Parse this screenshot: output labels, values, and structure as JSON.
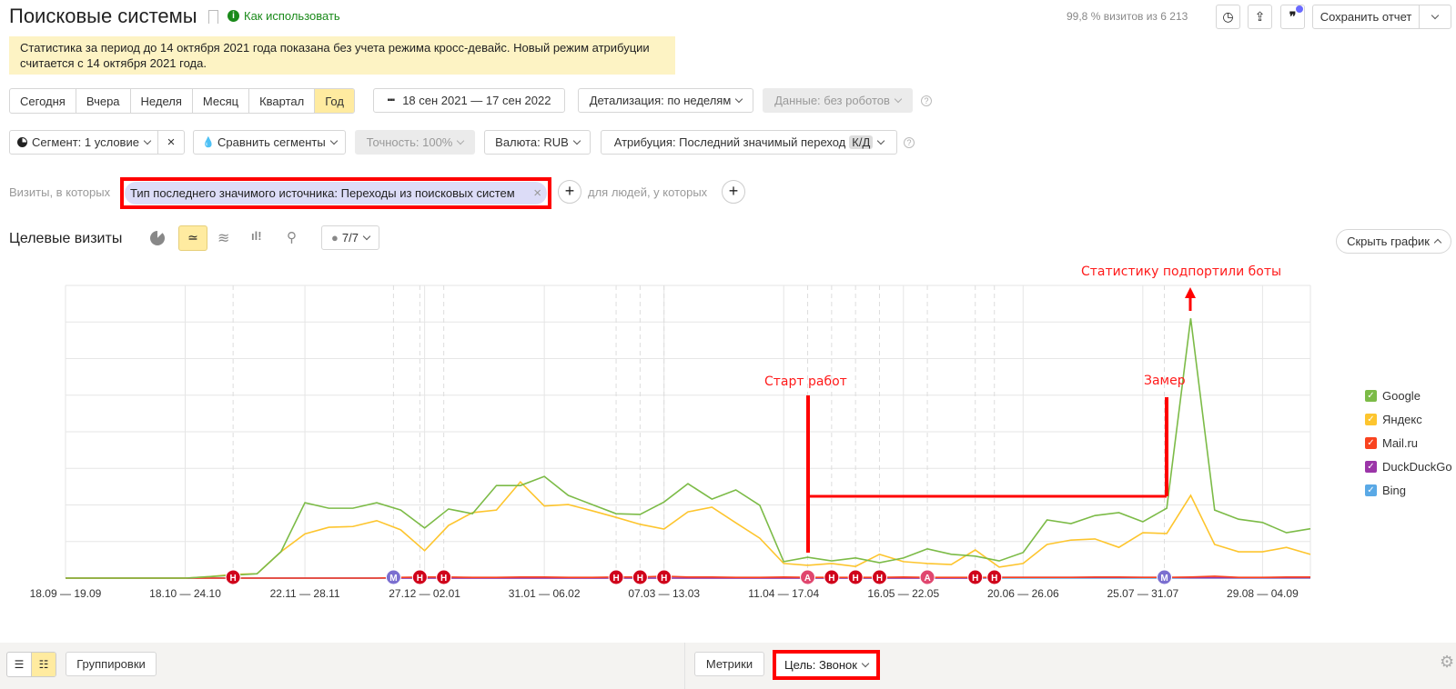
{
  "header": {
    "title": "Поисковые системы",
    "how_to": "Как использовать",
    "visits_info": "99,8 % визитов из 6 213",
    "save_report": "Сохранить отчет"
  },
  "notice": "Статистика за период до 14 октября 2021 года показана без учета режима кросс-девайс. Новый режим атрибуции считается с 14 октября 2021 года.",
  "periods": [
    {
      "label": "Сегодня"
    },
    {
      "label": "Вчера"
    },
    {
      "label": "Неделя"
    },
    {
      "label": "Месяц"
    },
    {
      "label": "Квартал"
    },
    {
      "label": "Год",
      "active": true
    }
  ],
  "date_range": "18 сен 2021 — 17 сен 2022",
  "detail": "Детализация: по неделям",
  "data_filter": "Данные: без роботов",
  "segment": "Сегмент: 1 условие",
  "compare": "Сравнить сегменты",
  "accuracy": "Точность: 100%",
  "currency": "Валюта: RUB",
  "attribution": "Атрибуция: Последний значимый переход",
  "attribution_badge": "К/Д",
  "filter": {
    "prefix": "Визиты, в которых",
    "chip": "Тип последнего значимого источника: Переходы из поисковых систем",
    "people": "для людей, у которых"
  },
  "chart_header": {
    "title": "Целевые визиты",
    "annotations_count": "7/7",
    "hide_chart": "Скрыть график",
    "active_view": "line"
  },
  "colors": {
    "accent": "#ffeba0",
    "highlight": "#ff0000"
  },
  "chart_data": {
    "type": "line",
    "ylim": [
      0,
      8
    ],
    "grid": true,
    "legend_placement": "right",
    "x_ticks": [
      {
        "index": 0,
        "label": "18.09 — 19.09"
      },
      {
        "index": 5,
        "label": "18.10 — 24.10"
      },
      {
        "index": 10,
        "label": "22.11 — 28.11"
      },
      {
        "index": 15,
        "label": "27.12 — 02.01"
      },
      {
        "index": 20,
        "label": "31.01 — 06.02"
      },
      {
        "index": 25,
        "label": "07.03 — 13.03"
      },
      {
        "index": 30,
        "label": "11.04 — 17.04"
      },
      {
        "index": 35,
        "label": "16.05 — 22.05"
      },
      {
        "index": 40,
        "label": "20.06 — 26.06"
      },
      {
        "index": 45,
        "label": "25.07 — 31.07"
      },
      {
        "index": 50,
        "label": "29.08 — 04.09"
      }
    ],
    "series": [
      {
        "name": "Google",
        "color": "#7cbb47",
        "values": [
          0,
          0,
          0,
          0,
          0,
          0,
          0.04,
          0.08,
          0.12,
          0.72,
          2.06,
          1.91,
          1.91,
          2.06,
          1.86,
          1.37,
          1.89,
          1.76,
          2.53,
          2.53,
          2.78,
          2.26,
          2.01,
          1.76,
          1.74,
          2.08,
          2.58,
          2.16,
          2.41,
          1.99,
          0.45,
          0.57,
          0.47,
          0.55,
          0.42,
          0.55,
          0.8,
          0.65,
          0.6,
          0.47,
          0.7,
          1.59,
          1.49,
          1.71,
          1.79,
          1.54,
          1.91,
          7.1,
          1.86,
          1.61,
          1.52,
          1.24,
          1.35
        ]
      },
      {
        "name": "Яндекс",
        "color": "#fdc52e",
        "values": [
          0,
          0,
          0,
          0,
          0,
          0,
          0.04,
          0.1,
          0.12,
          0.72,
          1.21,
          1.39,
          1.41,
          1.57,
          1.32,
          0.75,
          1.44,
          1.79,
          1.86,
          2.63,
          1.97,
          2.01,
          1.84,
          1.66,
          1.47,
          1.34,
          1.81,
          1.94,
          1.51,
          1.09,
          0.4,
          0.35,
          0.4,
          0.32,
          0.65,
          0.45,
          0.4,
          0.37,
          0.77,
          0.3,
          0.4,
          0.92,
          1.04,
          1.07,
          0.84,
          1.24,
          1.22,
          2.26,
          0.92,
          0.72,
          0.72,
          0.84,
          0.65
        ]
      },
      {
        "name": "Mail.ru",
        "color": "#f9431f",
        "values": [
          0,
          0,
          0,
          0,
          0,
          0,
          0,
          0,
          0,
          0,
          0,
          0,
          0,
          0,
          0.02,
          0.03,
          0.03,
          0.02,
          0.02,
          0.03,
          0.03,
          0.02,
          0.02,
          0.03,
          0.03,
          0.05,
          0.03,
          0.03,
          0.02,
          0.02,
          0.03,
          0.02,
          0.02,
          0.02,
          0.02,
          0.03,
          0.02,
          0.02,
          0.02,
          0.02,
          0.02,
          0.02,
          0.02,
          0.03,
          0.03,
          0.02,
          0.02,
          0.03,
          0.05,
          0.02,
          0.02,
          0.03,
          0.03
        ]
      },
      {
        "name": "DuckDuckGo",
        "color": "#9b35a8",
        "values": [
          0,
          0,
          0,
          0,
          0,
          0,
          0,
          0,
          0,
          0,
          0,
          0,
          0,
          0,
          0,
          0,
          0,
          0,
          0,
          0,
          0,
          0,
          0,
          0,
          0,
          0,
          0,
          0,
          0,
          0,
          0,
          0,
          0,
          0,
          0,
          0,
          0,
          0,
          0,
          0.02,
          0.02,
          0.02,
          0.02,
          0.02,
          0.02,
          0.02,
          0.02,
          0.01,
          0.01,
          0.01,
          0.01,
          0.01,
          0.01
        ]
      },
      {
        "name": "Bing",
        "color": "#5aa9e6",
        "values": [
          0,
          0,
          0,
          0,
          0,
          0,
          0,
          0,
          0,
          0,
          0,
          0,
          0,
          0,
          0,
          0,
          0,
          0,
          0,
          0,
          0,
          0,
          0,
          0,
          0,
          0,
          0,
          0,
          0,
          0,
          0,
          0,
          0,
          0,
          0,
          0,
          0,
          0,
          0,
          0,
          0,
          0,
          0,
          0,
          0,
          0,
          0,
          0,
          0,
          0,
          0,
          0,
          0
        ]
      }
    ],
    "event_markers": [
      {
        "index": 7,
        "letter": "Н"
      },
      {
        "index": 13.7,
        "letter": "М"
      },
      {
        "index": 14.8,
        "letter": "Н"
      },
      {
        "index": 15.8,
        "letter": "Н"
      },
      {
        "index": 23,
        "letter": "Н"
      },
      {
        "index": 24,
        "letter": "Н"
      },
      {
        "index": 25,
        "letter": "Н"
      },
      {
        "index": 31,
        "letter": "А"
      },
      {
        "index": 32,
        "letter": "Н"
      },
      {
        "index": 33,
        "letter": "Н"
      },
      {
        "index": 34,
        "letter": "Н"
      },
      {
        "index": 36,
        "letter": "А"
      },
      {
        "index": 38,
        "letter": "Н"
      },
      {
        "index": 38.8,
        "letter": "Н"
      },
      {
        "index": 45.9,
        "letter": "М"
      }
    ],
    "annotations": {
      "start": "Старт работ",
      "measure": "Замер",
      "bots": "Статистику подпортили боты"
    }
  },
  "bottom": {
    "groupings": "Группировки",
    "metrics": "Метрики",
    "goal": "Цель: Звонок"
  }
}
